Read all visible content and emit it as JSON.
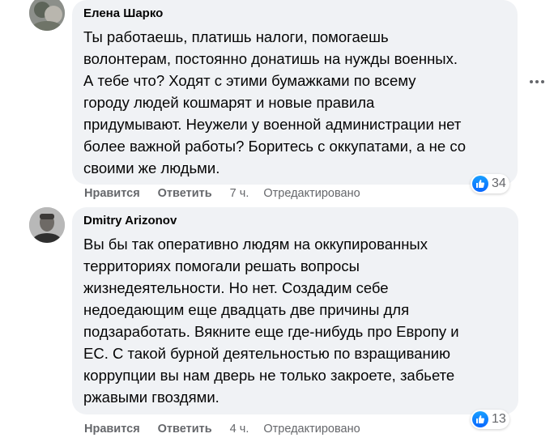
{
  "comments": [
    {
      "author": "Елена Шарко",
      "text": "Ты работаешь, платишь налоги, помогаешь\nволонтерам, постоянно донатишь на нужды военных.\nА тебе что? Ходят с этими бумажками по всему\nгороду людей кошмарят и новые правила\nпридумывают. Неужели у военной администрации нет\nболее важной работы? Боритесь с оккупатами, а не со\nсвоими же людьми.",
      "reaction_count": "34",
      "like_label": "Нравится",
      "reply_label": "Ответить",
      "time": "7 ч.",
      "edited": "Отредактировано"
    },
    {
      "author": "Dmitry Arizonov",
      "text": "Вы бы так оперативно людям на оккупированных\nтерриториях помогали решать вопросы\nжизнедеятельности. Но нет. Создадим себе\nнедоедающим еще двадцать две причины для\nподзаработать. Вякните еще где-нибудь про Европу и\nЕС. С такой бурной деятельностью по взращиванию\nкоррупции вы нам дверь не только закроете, забьете\nржавыми гвоздями.",
      "reaction_count": "13",
      "like_label": "Нравится",
      "reply_label": "Ответить",
      "time": "4 ч.",
      "edited": "Отредактировано"
    }
  ],
  "colors": {
    "bubble": "#f0f2f5",
    "secondary_text": "#65676b",
    "like_blue": "#0866ff"
  },
  "icons": [
    "like-icon",
    "more-options-icon",
    "avatar-image"
  ]
}
